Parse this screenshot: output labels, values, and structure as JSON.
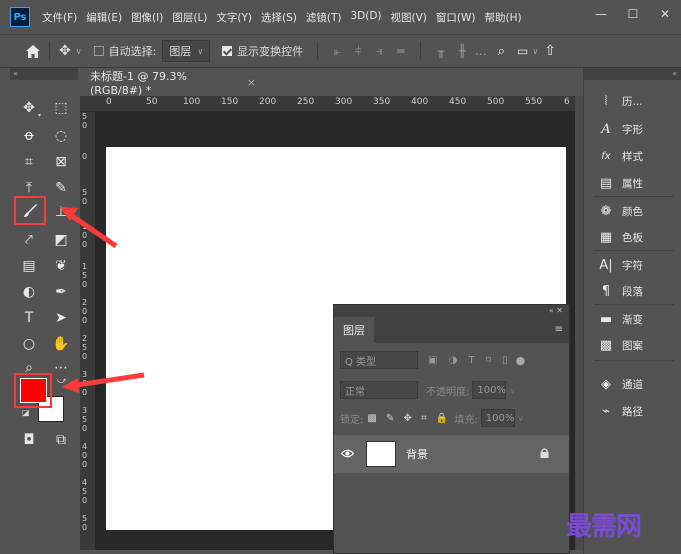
{
  "app": {
    "logo": "Ps",
    "menu": [
      "文件(F)",
      "编辑(E)",
      "图像(I)",
      "图层(L)",
      "文字(Y)",
      "选择(S)",
      "滤镜(T)",
      "3D(D)",
      "视图(V)",
      "窗口(W)",
      "帮助(H)"
    ],
    "window_controls": [
      "—",
      "☐",
      "✕"
    ]
  },
  "options": {
    "home_icon": "home-icon",
    "auto_select_label": "自动选择:",
    "auto_select_value": "图层",
    "show_transform_label": "显示变换控件"
  },
  "document": {
    "tab_title": "未标题-1 @ 79.3%(RGB/8#) *",
    "close": "×",
    "ruler_h": [
      "0",
      "50",
      "100",
      "150",
      "200",
      "250",
      "300",
      "350",
      "400",
      "450",
      "500",
      "550",
      "6"
    ],
    "ruler_v": [
      "5\n0",
      "0",
      "5\n0",
      "1\n0\n0",
      "1\n5\n0",
      "2\n0\n0",
      "2\n5\n0",
      "3\n0\n0",
      "3\n5\n0",
      "4\n0\n0",
      "4\n5\n0",
      "5\n0"
    ]
  },
  "tools": {
    "foreground_color": "#ff0000",
    "background_color": "#ffffff"
  },
  "right_dock": {
    "collapse": "«",
    "items": [
      {
        "icon": "history-icon",
        "glyph": "ⵖ",
        "label": "历..."
      },
      {
        "icon": "character-icon",
        "glyph": "𝒜",
        "label": "字形"
      },
      {
        "icon": "styles-icon",
        "glyph": "fx",
        "label": "样式"
      },
      {
        "icon": "properties-icon",
        "glyph": "▤",
        "label": "属性"
      },
      {
        "icon": "color-icon",
        "glyph": "❁",
        "label": "颜色"
      },
      {
        "icon": "swatches-icon",
        "glyph": "▦",
        "label": "色板"
      },
      {
        "icon": "character-panel-icon",
        "glyph": "A|",
        "label": "字符"
      },
      {
        "icon": "paragraph-icon",
        "glyph": "¶",
        "label": "段落"
      },
      {
        "icon": "gradient-icon",
        "glyph": "▬",
        "label": "渐变"
      },
      {
        "icon": "patterns-icon",
        "glyph": "▩",
        "label": "图案"
      },
      {
        "icon": "channels-icon",
        "glyph": "◈",
        "label": "通道"
      },
      {
        "icon": "paths-icon",
        "glyph": "⌁",
        "label": "路径"
      }
    ]
  },
  "layers_panel": {
    "controls": "«  ✕",
    "tab": "图层",
    "menu": "≡",
    "filter_kind": "Q 类型",
    "filter_icons": "▣ ◑ T ⌑ ▯",
    "blend_mode": "正常",
    "opacity_label": "不透明度:",
    "opacity_value": "100%",
    "lock_label": "锁定:",
    "lock_icons": "▩ ✎ ✥ ⌗ 🔒",
    "fill_label": "填充:",
    "fill_value": "100%",
    "layer_name": "背景",
    "layer_eye": "👁",
    "layer_lock": "🔒"
  },
  "watermark": "最需网"
}
